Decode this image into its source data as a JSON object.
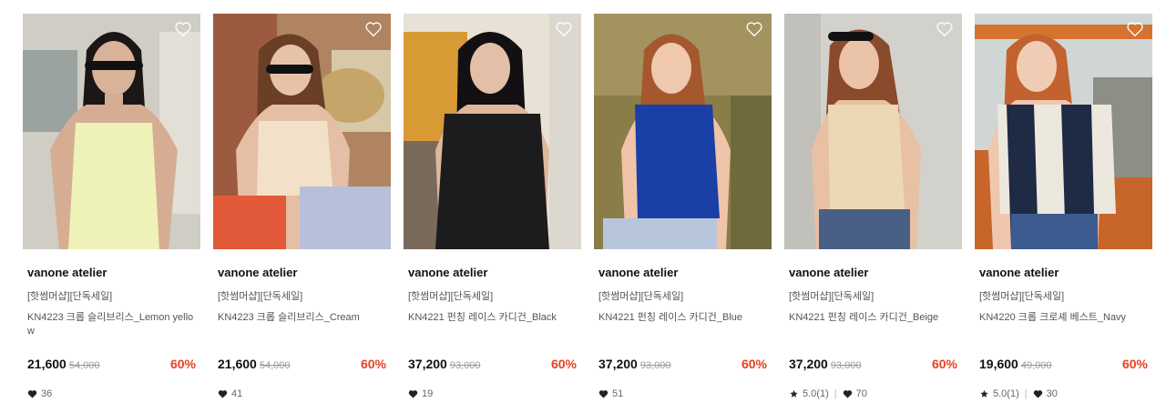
{
  "products": [
    {
      "brand": "vanone atelier",
      "tag": "[핫썸머샵][단독세일]",
      "name": "KN4223 크롭 슬리브리스_Lemon yellow",
      "price": "21,600",
      "original_price": "54,000",
      "discount": "60%",
      "rating": null,
      "likes": "36",
      "top_color": "#eef2b8",
      "bg_color": "#c9c7bc"
    },
    {
      "brand": "vanone atelier",
      "tag": "[핫썸머샵][단독세일]",
      "name": "KN4223 크롭 슬리브리스_Cream",
      "price": "21,600",
      "original_price": "54,000",
      "discount": "60%",
      "rating": null,
      "likes": "41",
      "top_color": "#f2e0c8",
      "bg_color": "#b9865a"
    },
    {
      "brand": "vanone atelier",
      "tag": "[핫썸머샵][단독세일]",
      "name": "KN4221 펀칭 레이스 카디건_Black",
      "price": "37,200",
      "original_price": "93,000",
      "discount": "60%",
      "rating": null,
      "likes": "19",
      "top_color": "#1c1c1e",
      "bg_color": "#d7a54a"
    },
    {
      "brand": "vanone atelier",
      "tag": "[핫썸머샵][단독세일]",
      "name": "KN4221 펀칭 레이스 카디건_Blue",
      "price": "37,200",
      "original_price": "93,000",
      "discount": "60%",
      "rating": null,
      "likes": "51",
      "top_color": "#1a3fa6",
      "bg_color": "#8a7a48"
    },
    {
      "brand": "vanone atelier",
      "tag": "[핫썸머샵][단독세일]",
      "name": "KN4221 펀칭 레이스 카디건_Beige",
      "price": "37,200",
      "original_price": "93,000",
      "discount": "60%",
      "rating": "5.0(1)",
      "likes": "70",
      "top_color": "#ecd9b4",
      "bg_color": "#cfcdc8"
    },
    {
      "brand": "vanone atelier",
      "tag": "[핫썸머샵][단독세일]",
      "name": "KN4220 크롭 크로셰 베스트_Navy",
      "price": "19,600",
      "original_price": "49,000",
      "discount": "60%",
      "rating": "5.0(1)",
      "likes": "30",
      "top_color": "#1f2a44",
      "bg_color": "#c86a2e"
    }
  ],
  "colors": {
    "discount": "#e8411e",
    "text": "#111111",
    "muted": "#999999"
  },
  "icons": {
    "wishlist": "heart-outline-icon",
    "likes": "heart-filled-icon",
    "rating": "star-icon"
  }
}
